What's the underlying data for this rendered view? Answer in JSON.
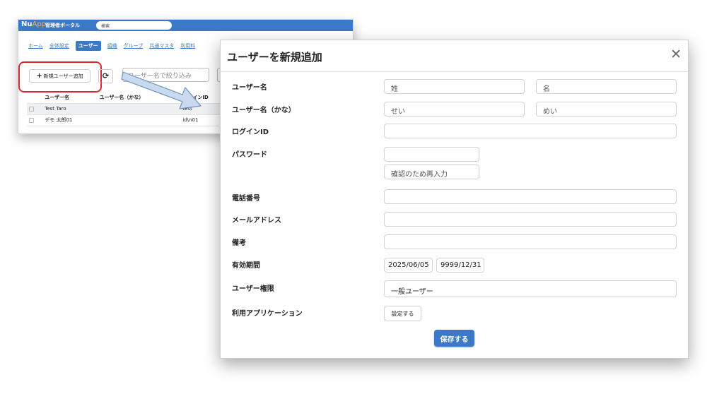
{
  "background_window": {
    "logo_main": "Nu",
    "logo_accent": "App",
    "portal_title": "管理者ポータル",
    "search_placeholder": "検索",
    "nav": [
      "ホーム",
      "全体設定",
      "ユーザー",
      "組織",
      "グループ",
      "共通マスタ",
      "利用料"
    ],
    "active_nav": "ユーザー",
    "add_user_button": "新規ユーザー追加",
    "filter_placeholder": "ユーザー名で絞り込み",
    "table": {
      "headers": [
        "",
        "ユーザー名",
        "ユーザー名（かな）",
        "ログインID"
      ],
      "rows": [
        [
          "",
          "Test Taro",
          "",
          "test"
        ],
        [
          "",
          "デモ 太郎01",
          "",
          "id\\n01"
        ]
      ]
    }
  },
  "modal": {
    "title": "ユーザーを新規追加",
    "close_icon": "close-icon",
    "fields": {
      "username_label": "ユーザー名",
      "last_name_placeholder": "姓",
      "first_name_placeholder": "名",
      "username_kana_label": "ユーザー名（かな）",
      "last_kana_placeholder": "せい",
      "first_kana_placeholder": "めい",
      "login_id_label": "ログインID",
      "password_label": "パスワード",
      "password_confirm_placeholder": "確認のため再入力",
      "phone_label": "電話番号",
      "email_label": "メールアドレス",
      "notes_label": "備考",
      "validity_label": "有効期間",
      "valid_from": "2025/06/05",
      "valid_to": "9999/12/31",
      "role_label": "ユーザー権限",
      "role_value": "一般ユーザー",
      "apps_label": "利用アプリケーション",
      "settings_button": "設定する"
    },
    "save_button": "保存する"
  },
  "colors": {
    "primary": "#3b78c8",
    "highlight_border": "#d42a2a",
    "logo_accent": "#f2b450"
  }
}
